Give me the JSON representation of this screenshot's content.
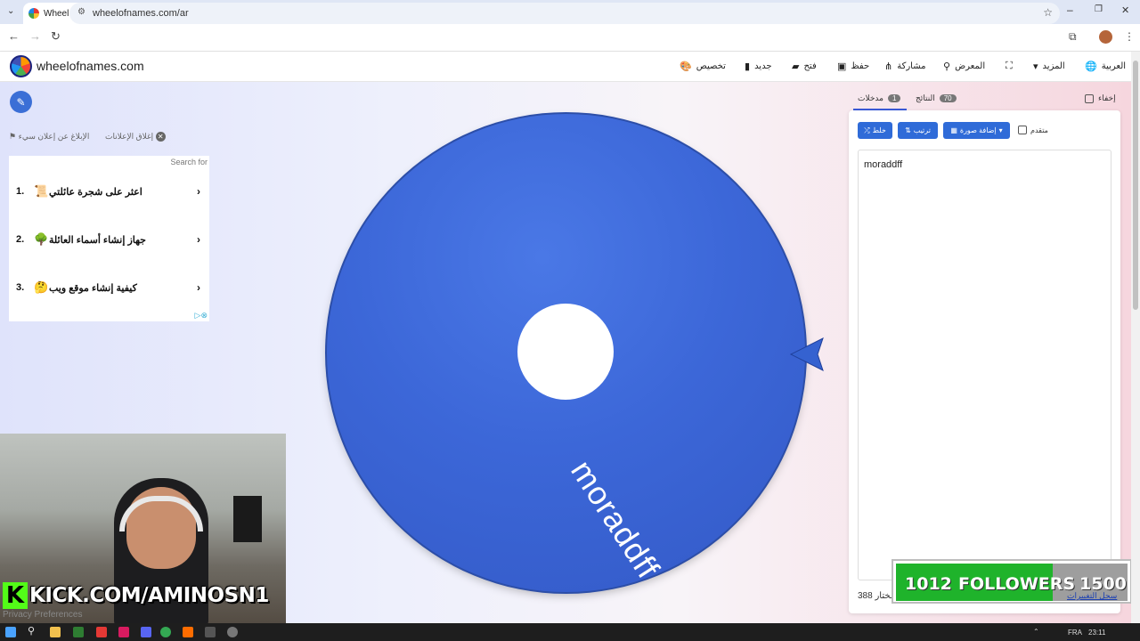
{
  "browser": {
    "tab_title": "Wheel of Names | اسم العشوائي",
    "url": "wheelofnames.com/ar",
    "new_tab": "+"
  },
  "site": {
    "brand": "wheelofnames.com",
    "menu": {
      "customize": "تخصيص",
      "new": "جديد",
      "open": "فتح",
      "save": "حفظ",
      "share": "مشاركة",
      "gallery": "المعرض",
      "more": "المزيد",
      "language": "العربية"
    }
  },
  "ads": {
    "close_ads": "إغلاق الإعلانات",
    "report_ad": "الإبلاغ عن إعلان سيء",
    "search_for": "Search for",
    "items": [
      {
        "num": "1.",
        "emoji": "📜",
        "text": "اعثر على شجرة عائلتي"
      },
      {
        "num": "2.",
        "emoji": "🌳",
        "text": "جهاز إنشاء أسماء العائلة"
      },
      {
        "num": "3.",
        "emoji": "🤔",
        "text": "كيفية إنشاء موقع ويب"
      }
    ]
  },
  "wheel": {
    "label": "moraddff",
    "color": "#3c67d8"
  },
  "panel": {
    "hide_label": "إخفاء",
    "results_tab": "النتائج",
    "results_count": "70",
    "entries_tab": "مدخلات",
    "entries_count": "1",
    "advanced_label": "متقدم",
    "add_image": "إضافة صورة",
    "sort": "ترتيب",
    "shuffle": "خلط",
    "entries_text": "moraddff",
    "counter_label": "مختار",
    "counter_value": "388",
    "changelog": "سجل التغييرات"
  },
  "stream": {
    "kick_letter": "K",
    "kick_url": "KICK.COM/AMINOSN1",
    "followers_current": "1012",
    "followers_label": "FOLLOWERS",
    "followers_goal": "1500",
    "followers_progress": 0.675,
    "privacy": "Privacy Preferences"
  },
  "taskbar": {
    "lang": "FRA",
    "time": "23:11"
  }
}
